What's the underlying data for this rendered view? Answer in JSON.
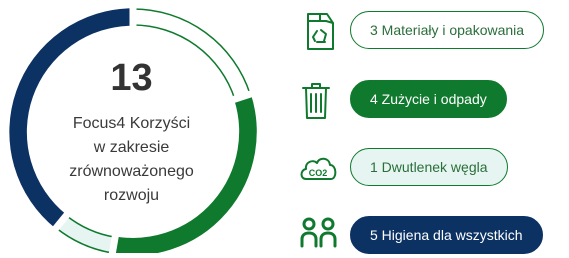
{
  "center": {
    "total": "13",
    "caption_lines": [
      "Focus4 Korzyści",
      "w zakresie",
      "zrównoważonego",
      "rozwoju"
    ]
  },
  "categories": [
    {
      "label": "3 Materiały i opakowania",
      "icon": "recycle-box-icon",
      "style": "outline",
      "count": 3,
      "color": "#ffffff"
    },
    {
      "label": "4 Zużycie i odpady",
      "icon": "trash-bin-icon",
      "style": "solid-green",
      "count": 4,
      "color": "#0f7a2e"
    },
    {
      "label": "1 Dwutlenek węgla",
      "icon": "co2-cloud-icon",
      "style": "light",
      "count": 1,
      "color": "#e6f5f1"
    },
    {
      "label": "5 Higiena dla wszystkich",
      "icon": "people-icon",
      "style": "navy",
      "count": 5,
      "color": "#0c3264"
    }
  ],
  "colors": {
    "green": "#0f7a2e",
    "navy": "#0c3264",
    "light": "#e6f5f1"
  }
}
